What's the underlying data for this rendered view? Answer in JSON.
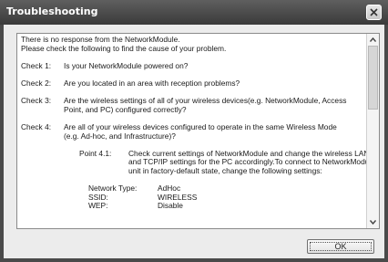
{
  "window": {
    "title": "Troubleshooting",
    "close_icon": "close-x-icon"
  },
  "content": {
    "intro": [
      "There is no response from the NetworkModule.",
      "Please check the following to find the cause of your problem."
    ],
    "checks": [
      {
        "label": "Check 1:",
        "lines": [
          "Is your NetworkModule powered on?"
        ]
      },
      {
        "label": "Check 2:",
        "lines": [
          "Are you located in an area with reception problems?"
        ]
      },
      {
        "label": "Check 3:",
        "lines": [
          "Are the wireless settings of all of your wireless devices(e.g. NetworkModule, Access",
          "Point, and PC) configured correctly?"
        ]
      },
      {
        "label": "Check 4:",
        "lines": [
          "Are all of your wireless devices configured to operate in the same Wireless Mode",
          "(e.g. Ad-hoc, and Infrastructure)?"
        ]
      }
    ],
    "point": {
      "label": "Point 4.1:",
      "lines": [
        "Check current settings of NetworkModule and change the wireless LAN",
        "and TCP/IP settings for the PC accordingly.To connect to NetworkModule",
        "unit in factory-default state, change the following settings:"
      ]
    },
    "settings": [
      {
        "key": "Network Type:",
        "value": "AdHoc"
      },
      {
        "key": "SSID:",
        "value": "WIRELESS"
      },
      {
        "key": "WEP:",
        "value": "Disable"
      }
    ]
  },
  "scrollbar": {
    "up_icon": "scroll-up-arrow-icon",
    "down_icon": "scroll-down-arrow-icon"
  },
  "buttons": {
    "ok_label": "OK"
  }
}
